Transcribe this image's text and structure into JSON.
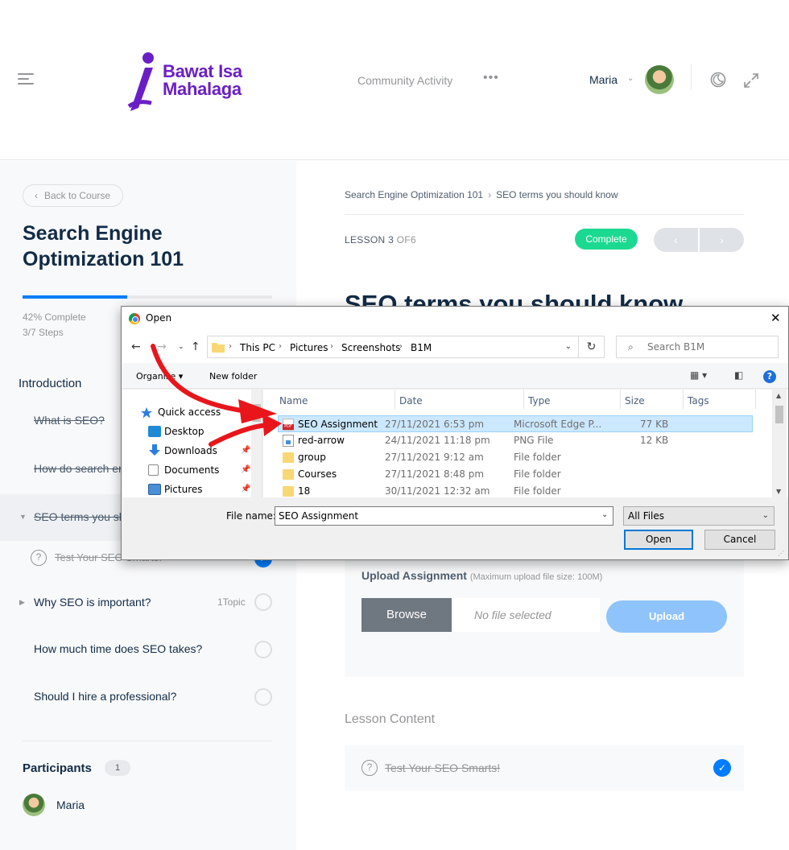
{
  "header": {
    "logo_line1": "Bawat Isa",
    "logo_line2": "Mahalaga",
    "nav_link": "Community Activity",
    "more": "•••",
    "user_name": "Maria",
    "caret": "⌄"
  },
  "sidebar": {
    "back_label": "Back to Course",
    "course_title": "Search Engine Optimization 101",
    "progress_percent": 42,
    "progress_label": "42% Complete",
    "steps_label": "3/7 Steps",
    "section": "Introduction",
    "lessons": [
      {
        "label": "What is SEO?"
      },
      {
        "label": "How do search engines work?"
      },
      {
        "label": "SEO terms you should know"
      },
      {
        "label": "Test Your SEO Smarts!"
      },
      {
        "label": "Why SEO is important?",
        "topic_count": "1Topic"
      },
      {
        "label": "How much time does SEO takes?"
      },
      {
        "label": "Should I hire a professional?"
      }
    ],
    "participants_label": "Participants",
    "participants_count": "1",
    "participant_name": "Maria"
  },
  "main": {
    "breadcrumb": [
      "Search Engine Optimization 101",
      "SEO terms you should know"
    ],
    "breadcrumb_sep": "›",
    "lesson_label": "LESSON 3",
    "lesson_of": "OF6",
    "complete_label": "Complete",
    "prev": "‹",
    "next": "›",
    "lesson_title": "SEO terms you should know",
    "upload_label": "Upload Assignment",
    "upload_note": "(Maximum upload file size: 100M)",
    "browse_label": "Browse",
    "no_file": "No file selected",
    "upload_btn": "Upload",
    "lesson_content_head": "Lesson Content",
    "lesson_content_item": "Test Your SEO Smarts!"
  },
  "dialog": {
    "title": "Open",
    "close": "✕",
    "path": [
      "This PC",
      "Pictures",
      "Screenshots",
      "B1M"
    ],
    "search_placeholder": "Search B1M",
    "organise": "Organise ▾",
    "new_folder": "New folder",
    "nav": [
      {
        "label": "Quick access",
        "icon": "star-icon"
      },
      {
        "label": "Desktop",
        "icon": "desktop-icon"
      },
      {
        "label": "Downloads",
        "icon": "download-icon"
      },
      {
        "label": "Documents",
        "icon": "document-icon"
      },
      {
        "label": "Pictures",
        "icon": "pictures-icon"
      }
    ],
    "columns": [
      "Name",
      "Date",
      "Type",
      "Size",
      "Tags"
    ],
    "files": [
      {
        "name": "SEO Assignment",
        "date": "27/11/2021 6:53 pm",
        "type": "Microsoft Edge P...",
        "size": "77 KB",
        "icon": "pdf-icon"
      },
      {
        "name": "red-arrow",
        "date": "24/11/2021 11:18 pm",
        "type": "PNG File",
        "size": "12 KB",
        "icon": "png-icon"
      },
      {
        "name": "group",
        "date": "27/11/2021 9:12 am",
        "type": "File folder",
        "size": "",
        "icon": "folder-icon"
      },
      {
        "name": "Courses",
        "date": "27/11/2021 8:48 pm",
        "type": "File folder",
        "size": "",
        "icon": "folder-icon"
      },
      {
        "name": "18",
        "date": "30/11/2021 12:32 am",
        "type": "File folder",
        "size": "",
        "icon": "folder-icon"
      }
    ],
    "file_name_label": "File name:",
    "file_name_value": "SEO Assignment",
    "filter": "All Files",
    "open_btn": "Open",
    "cancel_btn": "Cancel"
  },
  "colors": {
    "brand_purple": "#6a1fc6",
    "accent_blue": "#007cff",
    "complete_green": "#1cd991",
    "annotation_red": "#e8161b"
  }
}
